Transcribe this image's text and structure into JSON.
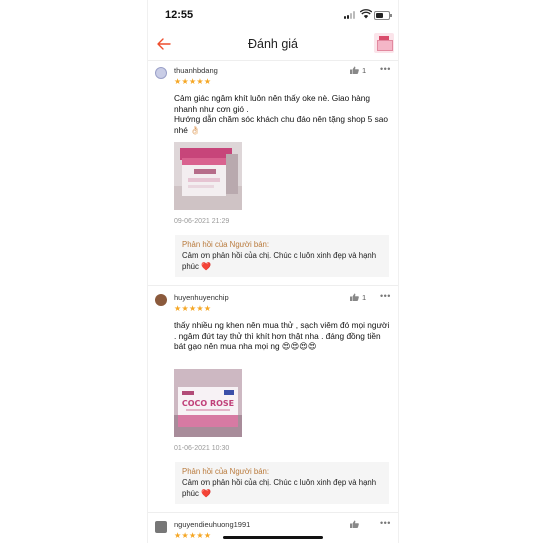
{
  "status_bar": {
    "time": "12:55"
  },
  "header": {
    "title": "Đánh giá"
  },
  "reviews": [
    {
      "username": "thuanhbdang",
      "stars": "★★★★★",
      "likes": "1",
      "comment": "Cảm giác ngâm khít luôn nên thấy oke nè. Giao hàng nhanh như cơn gió .\nHướng dẫn chăm sóc khách chu đáo nên tặng shop 5 sao nhé 👌🏻",
      "date": "09-06-2021 21:29",
      "reply_label": "Phản hồi của Người bán:",
      "reply_text": "Cảm ơn phản hồi của chị. Chúc c luôn xinh đẹp và hạnh phúc",
      "reply_heart": "❤️"
    },
    {
      "username": "huyenhuyenchip",
      "stars": "★★★★★",
      "likes": "1",
      "comment": "thấy nhiều ng khen nên mua thử , sạch viêm đó mọi người . ngâm đứt tay thử thì khít hơn thật nha . đáng đồng tiền bát gạo nên mua nha mọi ng 😍😍😍😍",
      "photo_brand": "COCO ROSE",
      "date": "01-06-2021 10:30",
      "reply_label": "Phản hồi của Người bán:",
      "reply_text": "Cảm ơn phản hồi của chị. Chúc c luôn xinh đẹp và hạnh phúc",
      "reply_heart": "❤️"
    },
    {
      "username": "nguyendieuhuong1991",
      "stars": "★★★★★",
      "likes": ""
    }
  ],
  "colors": {
    "accent": "#ee4d2d",
    "star": "#f5a623",
    "reply_label": "#b97a3c",
    "heart": "#e0002a"
  },
  "icons": [
    "back-arrow-icon",
    "thumb-up-icon",
    "more-dots-icon",
    "star-icon",
    "heart-icon"
  ]
}
